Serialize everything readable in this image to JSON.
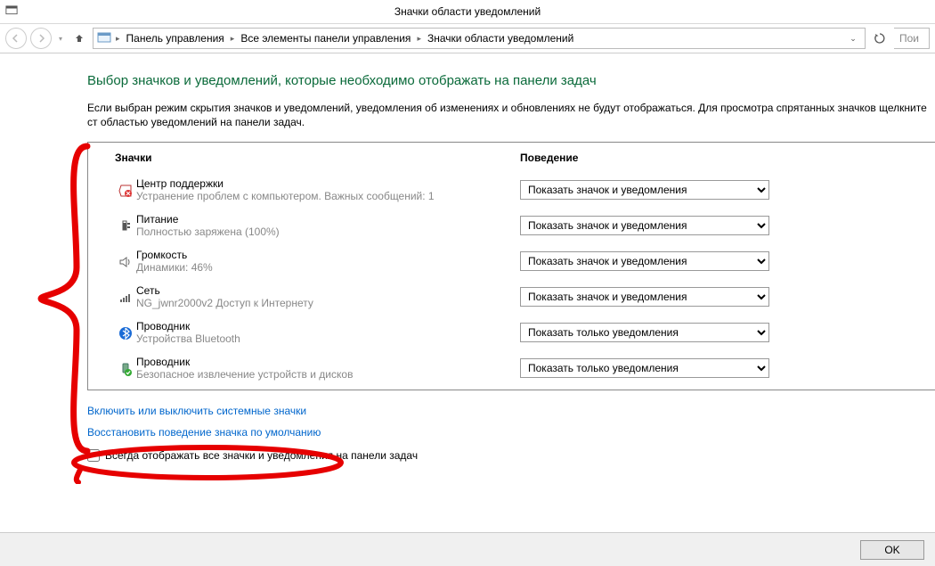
{
  "window": {
    "title": "Значки области уведомлений"
  },
  "breadcrumb": {
    "item1": "Панель управления",
    "item2": "Все элементы панели управления",
    "item3": "Значки области уведомлений",
    "search_placeholder": "Пои"
  },
  "page": {
    "heading": "Выбор значков и уведомлений, которые необходимо отображать на панели задач",
    "description": "Если выбран режим скрытия значков и уведомлений, уведомления об изменениях и обновлениях не будут отображаться. Для просмотра спрятанных значков щелкните ст областью уведомлений на панели задач."
  },
  "columns": {
    "icons": "Значки",
    "behavior": "Поведение"
  },
  "options": {
    "show_icon_notif": "Показать значок и уведомления",
    "show_notif_only": "Показать только уведомления"
  },
  "items": [
    {
      "title": "Центр поддержки",
      "sub": "Устранение проблем с компьютером. Важных сообщений: 1",
      "selected": "show_icon_notif"
    },
    {
      "title": "Питание",
      "sub": "Полностью заряжена (100%)",
      "selected": "show_icon_notif"
    },
    {
      "title": "Громкость",
      "sub": "Динамики: 46%",
      "selected": "show_icon_notif"
    },
    {
      "title": "Сеть",
      "sub": "NG_jwnr2000v2 Доступ к Интернету",
      "selected": "show_icon_notif"
    },
    {
      "title": "Проводник",
      "sub": "Устройства Bluetooth",
      "selected": "show_notif_only"
    },
    {
      "title": "Проводник",
      "sub": "Безопасное извлечение устройств и дисков",
      "selected": "show_notif_only"
    }
  ],
  "links": {
    "system_icons": "Включить или выключить системные значки",
    "restore_defaults": "Восстановить поведение значка по умолчанию"
  },
  "checkbox": {
    "label": "Всегда отображать все значки и уведомления на панели задач"
  },
  "buttons": {
    "ok": "OK"
  }
}
